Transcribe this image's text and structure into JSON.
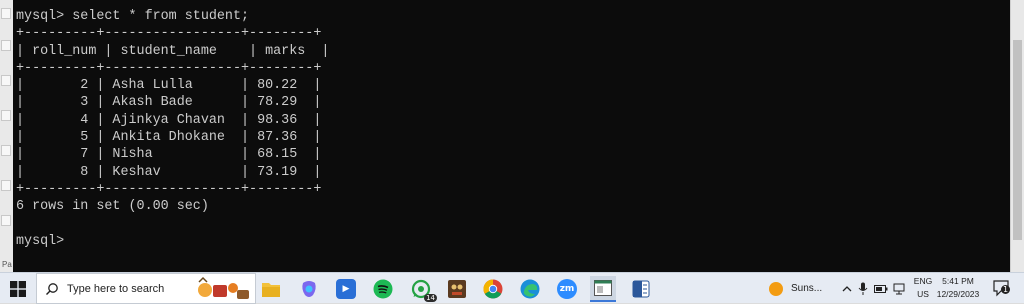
{
  "terminal": {
    "lines": [
      "mysql> select * from student;",
      "+---------+-----------------+--------+",
      "| roll_num | student_name    | marks  |",
      "+---------+-----------------+--------+",
      "|       2 | Asha Lulla      | 80.22  |",
      "|       3 | Akash Bade      | 78.29  |",
      "|       4 | Ajinkya Chavan  | 98.36  |",
      "|       5 | Ankita Dhokane  | 87.36  |",
      "|       7 | Nisha           | 68.15  |",
      "|       8 | Keshav          | 73.19  |",
      "+---------+-----------------+--------+",
      "6 rows in set (0.00 sec)",
      "",
      "mysql>"
    ]
  },
  "left_strip": {
    "label": "Pa"
  },
  "taskbar": {
    "search_placeholder": "Type here to search",
    "weather_text": "Suns...",
    "language_top": "ENG",
    "language_bottom": "US",
    "time": "5:41 PM",
    "date": "12/29/2023",
    "whatsapp_badge": "14",
    "notification_count": "1",
    "apps": [
      {
        "name": "file-explorer-icon",
        "color": "#e8b93a"
      },
      {
        "name": "copilot-icon",
        "color": "#6a5ae0"
      },
      {
        "name": "teams-icon",
        "color": "#2a6fd6"
      },
      {
        "name": "spotify-icon",
        "color": "#1db954"
      },
      {
        "name": "whatsapp-icon",
        "color": "#25a244"
      },
      {
        "name": "game-icon",
        "color": "#7a4a2a"
      },
      {
        "name": "chrome-icon",
        "color": "#db4437"
      },
      {
        "name": "edge-icon",
        "color": "#1a8fd8"
      },
      {
        "name": "zoom-icon",
        "color": "#2d8cff"
      },
      {
        "name": "window-app-icon",
        "color": "#2f7d54"
      },
      {
        "name": "word-icon",
        "color": "#2b579a"
      }
    ],
    "colors": {
      "terminal_bg": "#0c0c0c",
      "terminal_fg": "#cccccc",
      "taskbar_bg": "#e6ebf3"
    }
  }
}
